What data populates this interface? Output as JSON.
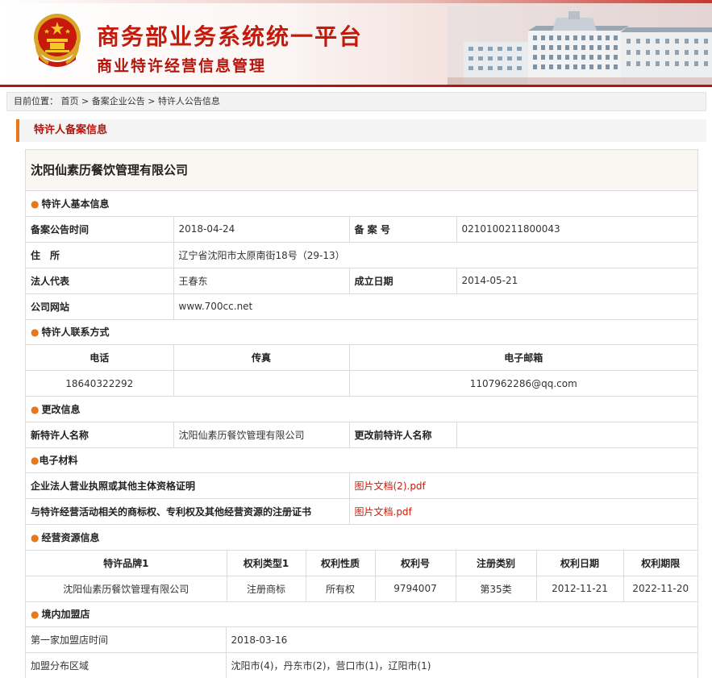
{
  "header": {
    "title_main": "商务部业务系统统一平台",
    "title_sub": "商业特许经营信息管理"
  },
  "breadcrumb": {
    "prefix": "目前位置：",
    "items": [
      "首页",
      "备案企业公告",
      "特许人公告信息"
    ],
    "separator": ">"
  },
  "section_title": "特许人备案信息",
  "company_name": "沈阳仙素历餐饮管理有限公司",
  "basic_info": {
    "heading": "特许人基本信息",
    "announce_date_label": "备案公告时间",
    "announce_date": "2018-04-24",
    "record_no_label": "备 案 号",
    "record_no": "0210100211800043",
    "address_label": "住　所",
    "address": "辽宁省沈阳市太原南街18号（29-13）",
    "legal_rep_label": "法人代表",
    "legal_rep": "王春东",
    "founded_label": "成立日期",
    "founded": "2014-05-21",
    "website_label": "公司网站",
    "website": "www.700cc.net"
  },
  "contact": {
    "heading": "特许人联系方式",
    "phone_label": "电话",
    "fax_label": "传真",
    "email_label": "电子邮箱",
    "phone": "18640322292",
    "fax": "",
    "email": "1107962286@qq.com"
  },
  "change_info": {
    "heading": "更改信息",
    "new_name_label": "新特许人名称",
    "new_name": "沈阳仙素历餐饮管理有限公司",
    "old_name_label": "更改前特许人名称",
    "old_name": ""
  },
  "materials": {
    "heading": "电子材料",
    "license_label": "企业法人营业执照或其他主体资格证明",
    "license_file": "图片文档(2).pdf",
    "trademark_label": "与特许经营活动相关的商标权、专利权及其他经营资源的注册证书",
    "trademark_file": "图片文档.pdf"
  },
  "resources": {
    "heading": "经营资源信息",
    "columns": [
      "特许品牌1",
      "权利类型1",
      "权利性质",
      "权利号",
      "注册类别",
      "权利日期",
      "权利期限"
    ],
    "rows": [
      [
        "沈阳仙素历餐饮管理有限公司",
        "注册商标",
        "所有权",
        "9794007",
        "第35类",
        "2012-11-21",
        "2022-11-20"
      ]
    ]
  },
  "stores": {
    "heading": "境内加盟店",
    "first_store_label": "第一家加盟店时间",
    "first_store_date": "2018-03-16",
    "area_label": "加盟分布区域",
    "areas": "沈阳市(4)，丹东市(2)，营口市(1)，辽阳市(1)"
  },
  "colors": {
    "brand_red": "#c41a0c",
    "accent_orange": "#e7781c",
    "link_red": "#cc1a0c"
  }
}
